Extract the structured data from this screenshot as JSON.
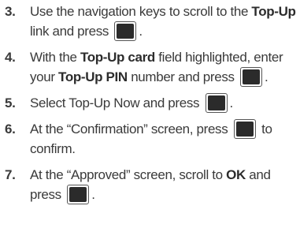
{
  "steps": [
    {
      "number": "3.",
      "line1_pre": "Use the navigation keys to scroll to the ",
      "line1_bold": "Top-Up",
      "line2_pre": "link and press",
      "line2_post": ".",
      "key_icon": "ok-key-icon"
    },
    {
      "number": "4.",
      "line1_pre": "With the ",
      "line1_bold": "Top-Up card",
      "line1_post": " field highlighted, enter",
      "line2_pre": "your ",
      "line2_bold": "Top-Up PIN",
      "line2_mid": " number and press",
      "line2_post": ".",
      "key_icon": "ok-key-icon"
    },
    {
      "number": "5.",
      "line1_pre": "Select Top-Up Now and press",
      "line1_post": ".",
      "key_icon": "ok-key-icon"
    },
    {
      "number": "6.",
      "line1_pre": "At the “Confirmation” screen, press",
      "line1_post": "to",
      "line2_pre": "confirm.",
      "key_icon": "ok-key-icon"
    },
    {
      "number": "7.",
      "line1_pre": "At the “Approved” screen, scroll to ",
      "line1_bold": "OK",
      "line1_post": " and",
      "line2_pre": "press",
      "line2_post": ".",
      "key_icon": "ok-key-icon"
    }
  ]
}
